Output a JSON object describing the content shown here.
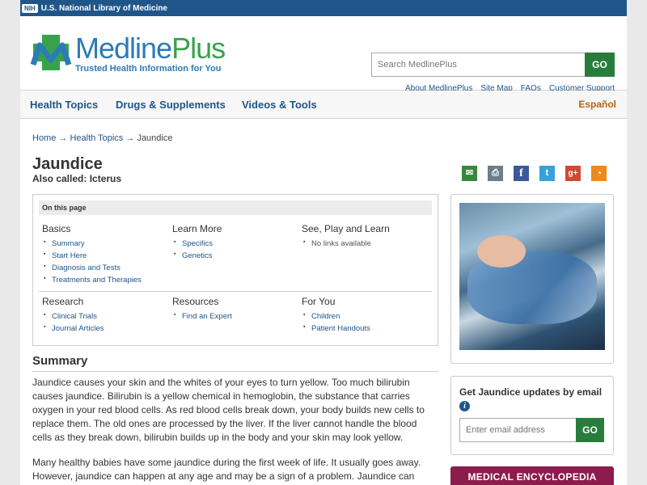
{
  "nih_bar": {
    "badge": "NIH",
    "text": "U.S. National Library of Medicine"
  },
  "logo": {
    "name_a": "Medline",
    "name_b": "Plus",
    "tagline": "Trusted Health Information for You"
  },
  "search": {
    "placeholder": "Search MedlinePlus",
    "button": "GO"
  },
  "util_links": [
    "About MedlinePlus",
    "Site Map",
    "FAQs",
    "Customer Support"
  ],
  "nav": {
    "items": [
      "Health Topics",
      "Drugs & Supplements",
      "Videos & Tools"
    ],
    "lang": "Español"
  },
  "breadcrumb": {
    "home": "Home",
    "sep1": " → ",
    "topics": "Health Topics",
    "sep2": " → ",
    "current": "Jaundice"
  },
  "page": {
    "title": "Jaundice",
    "also_called": "Also called: Icterus"
  },
  "share_icons": [
    "email-icon",
    "print-icon",
    "facebook-icon",
    "twitter-icon",
    "google-plus-icon",
    "rss-icon"
  ],
  "on_this_page": {
    "label": "On this page",
    "sections": [
      {
        "title": "Basics",
        "links": [
          "Summary",
          "Start Here",
          "Diagnosis and Tests",
          "Treatments and Therapies"
        ]
      },
      {
        "title": "Learn More",
        "links": [
          "Specifics",
          "Genetics"
        ]
      },
      {
        "title": "See, Play and Learn",
        "links": [
          "No links available"
        ]
      },
      {
        "title": "Research",
        "links": [
          "Clinical Trials",
          "Journal Articles"
        ]
      },
      {
        "title": "Resources",
        "links": [
          "Find an Expert"
        ]
      },
      {
        "title": "For You",
        "links": [
          "Children",
          "Patient Handouts"
        ]
      }
    ]
  },
  "summary": {
    "heading": "Summary",
    "p1": "Jaundice causes your skin and the whites of your eyes to turn yellow. Too much bilirubin causes jaundice. Bilirubin is a yellow chemical in hemoglobin, the substance that carries oxygen in your red blood cells. As red blood cells break down, your body builds new cells to replace them. The old ones are processed by the liver. If the liver cannot handle the blood cells as they break down, bilirubin builds up in the body and your skin may look yellow.",
    "p2": "Many healthy babies have some jaundice during the first week of life. It usually goes away. However, jaundice can happen at any age and may be a sign of a problem. Jaundice can happen for many"
  },
  "email_signup": {
    "heading": "Get Jaundice updates by email",
    "placeholder": "Enter email address",
    "button": "GO"
  },
  "encyclopedia": {
    "label": "MEDICAL ENCYCLOPEDIA"
  },
  "colors": {
    "nih_blue": "#20558a",
    "go_green": "#287d3c",
    "espanol": "#b96315",
    "encyclopedia": "#8b1c4c"
  }
}
